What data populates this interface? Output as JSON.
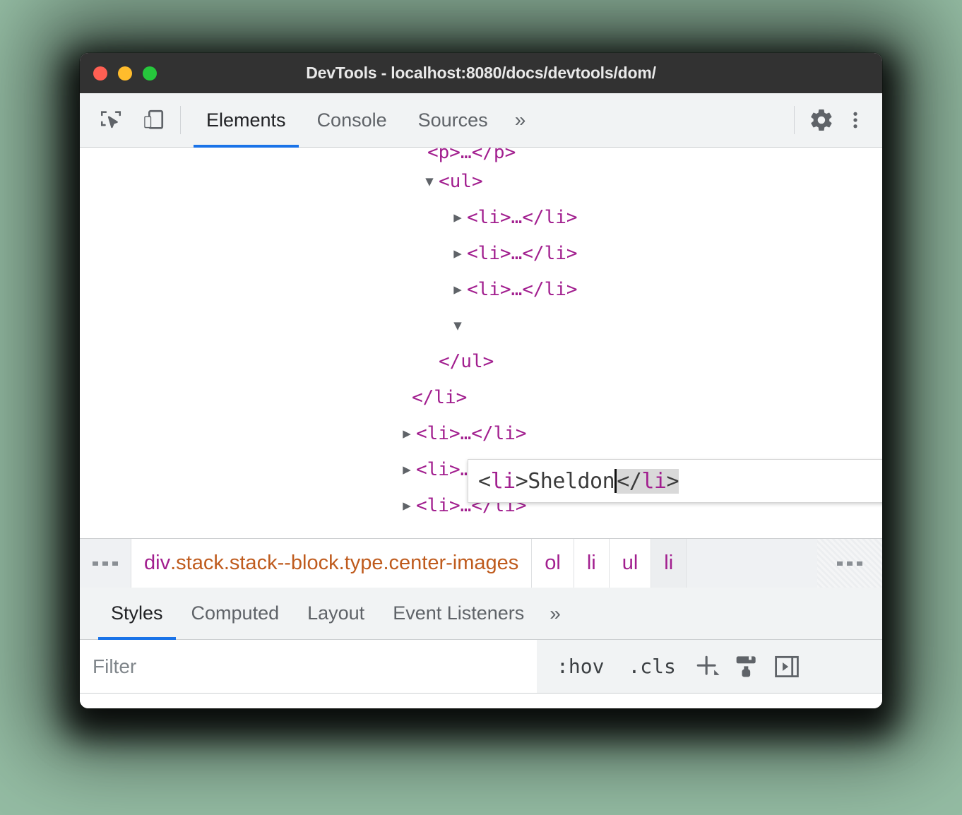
{
  "window": {
    "title": "DevTools - localhost:8080/docs/devtools/dom/",
    "traffic_lights": {
      "close": "close-button",
      "minimize": "minimize-button",
      "zoom": "zoom-button"
    },
    "colors": {
      "titlebar_bg": "#323232",
      "close": "#ff5f53",
      "minimize": "#ffbc2c",
      "zoom": "#26c73c",
      "accent": "#1a73e8",
      "tag_purple": "#a21f8f",
      "class_orange": "#bf5b1d",
      "toolbar_bg": "#f1f3f4",
      "page_bg": "#94bca3"
    }
  },
  "toolbar": {
    "inspect_icon": "inspect-element-icon",
    "device_icon": "device-toolbar-icon",
    "tabs": [
      {
        "label": "Elements",
        "active": true
      },
      {
        "label": "Console",
        "active": false
      },
      {
        "label": "Sources",
        "active": false
      }
    ],
    "more_tabs_label": "»",
    "settings_icon": "gear-icon",
    "menu_icon": "more-vertical-icon"
  },
  "dom_tree": {
    "rows": [
      {
        "id": "p-cut",
        "indent": 0,
        "triangle": "",
        "text": "<p>…</p>",
        "cut": true
      },
      {
        "id": "ul-open",
        "indent": 0,
        "triangle": "▼",
        "text": "<ul>"
      },
      {
        "id": "li-1",
        "indent": 1,
        "triangle": "▶",
        "text": "<li>…</li>"
      },
      {
        "id": "li-2",
        "indent": 1,
        "triangle": "▶",
        "text": "<li>…</li>"
      },
      {
        "id": "li-3",
        "indent": 1,
        "triangle": "▶",
        "text": "<li>…</li>"
      },
      {
        "id": "li-edit",
        "indent": 1,
        "triangle": "▼",
        "text": ""
      },
      {
        "id": "ul-close",
        "indent": 0,
        "triangle": "",
        "text": "</ul>"
      },
      {
        "id": "li-close",
        "indent": -1,
        "triangle": "",
        "text": "</li>"
      },
      {
        "id": "li-4",
        "indent": -1,
        "triangle": "▶",
        "text": "<li>…</li>"
      },
      {
        "id": "li-5",
        "indent": -1,
        "triangle": "▶",
        "text": "<li>…</li>"
      },
      {
        "id": "li-6",
        "indent": -1,
        "triangle": "▶",
        "text": "<li>…</li>"
      }
    ]
  },
  "edit_box": {
    "open_bracket": "<",
    "open_tag": "li",
    "close_bracket": ">",
    "value": "Sheldon",
    "selection": "</li>",
    "full_text": "<li>Sheldon</li>",
    "caret_after": "Sheldon"
  },
  "breadcrumb": {
    "leading_overflow": "…",
    "items": [
      {
        "tag": "div",
        "classes": ".stack.stack--block.type.center-images",
        "selected": false,
        "white": true
      },
      {
        "tag": "ol",
        "classes": "",
        "selected": false,
        "white": true
      },
      {
        "tag": "li",
        "classes": "",
        "selected": false,
        "white": true
      },
      {
        "tag": "ul",
        "classes": "",
        "selected": false,
        "white": true
      },
      {
        "tag": "li",
        "classes": "",
        "selected": true,
        "white": false
      }
    ],
    "trailing_overflow": "…"
  },
  "styles_pane": {
    "tabs": [
      {
        "label": "Styles",
        "active": true
      },
      {
        "label": "Computed",
        "active": false
      },
      {
        "label": "Layout",
        "active": false
      },
      {
        "label": "Event Listeners",
        "active": false
      }
    ],
    "more_tabs_label": "»",
    "filter": {
      "placeholder": "Filter",
      "value": ""
    },
    "hov_label": ":hov",
    "cls_label": ".cls",
    "new_rule_icon": "plus-icon",
    "print_styles_icon": "paintbrush-icon",
    "toggle_sidebar_icon": "collapse-panel-icon"
  }
}
